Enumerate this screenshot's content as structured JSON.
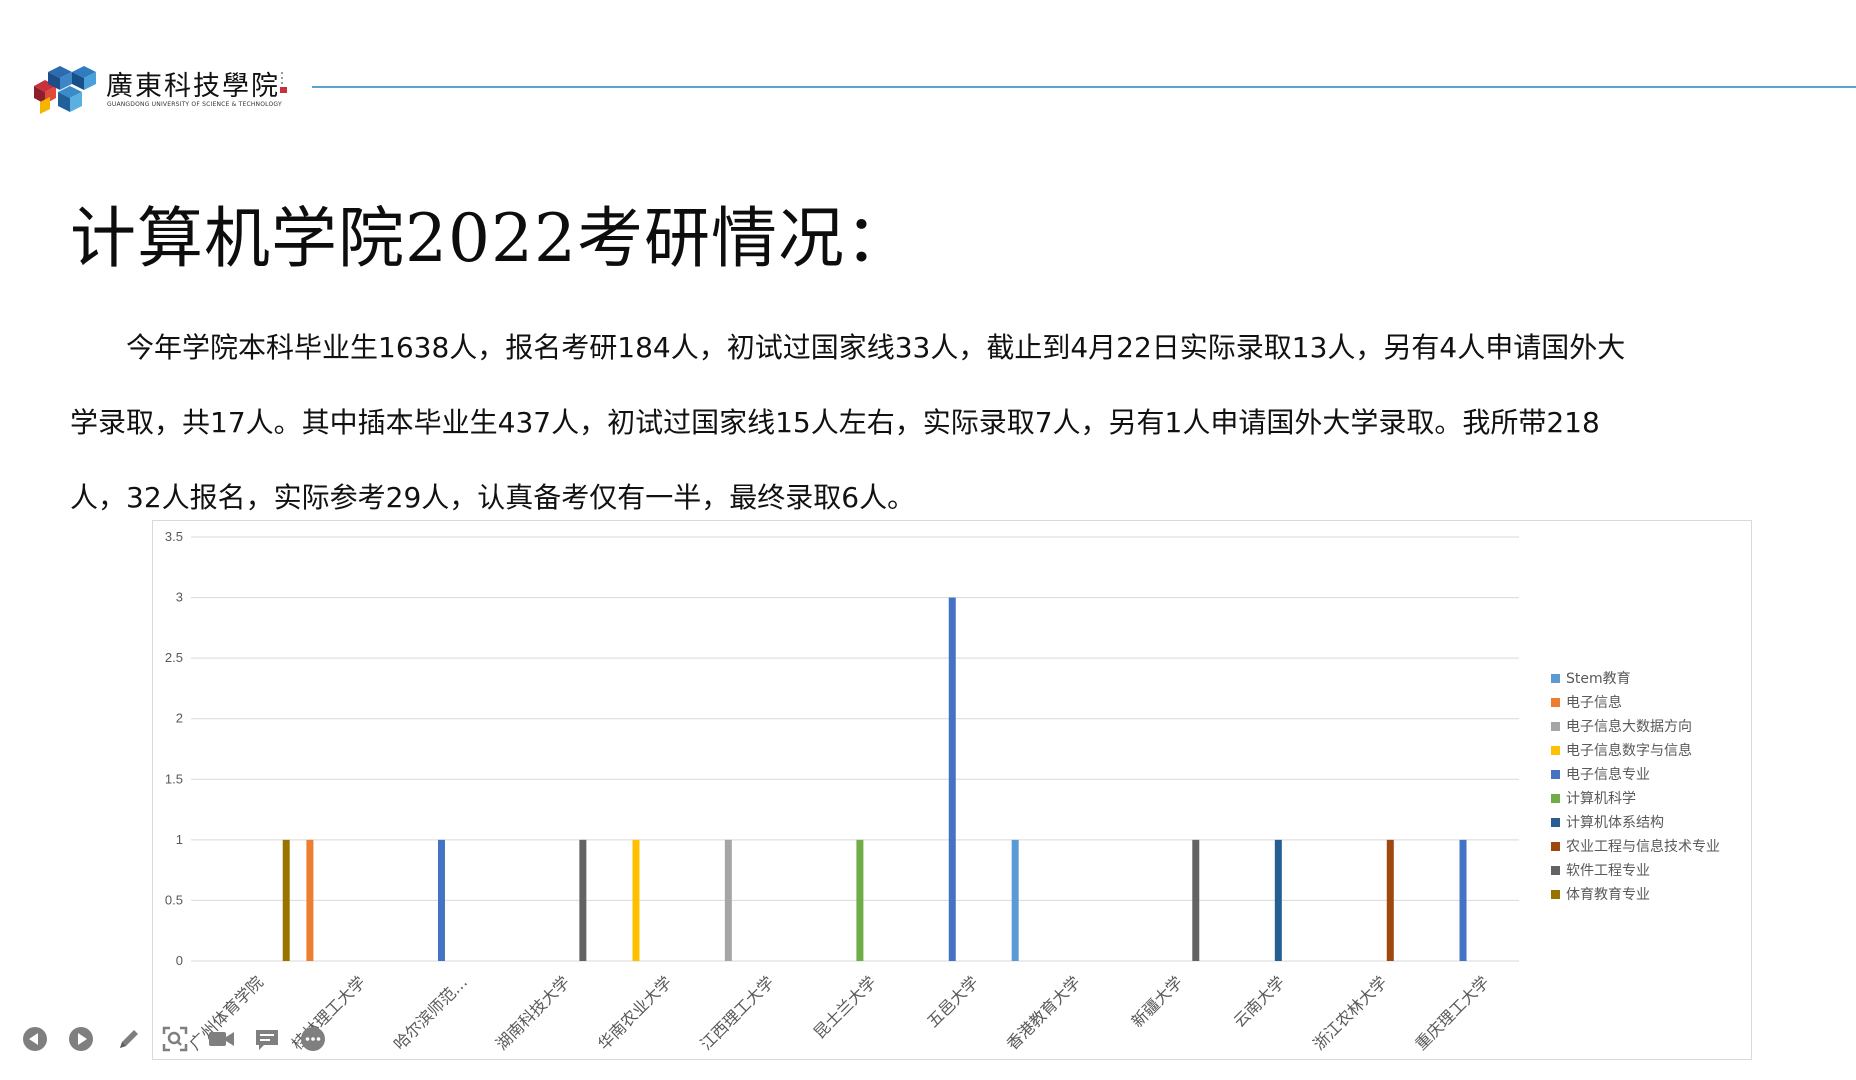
{
  "header": {
    "school_name": "廣東科技學院",
    "school_name_en": "GUANGDONG UNIVERSITY OF SCIENCE & TECHNOLOGY"
  },
  "slide": {
    "title": "计算机学院2022考研情况：",
    "paragraph_lines": [
      "　　今年学院本科毕业生1638人，报名考研184人，初试过国家线33人，截止到4月22日实际录取13人，另有4人申请国外大",
      "学录取，共17人。其中插本毕业生437人，初试过国家线15人左右，实际录取7人，另有1人申请国外大学录取。我所带218",
      "人，32人报名，实际参考29人，认真备考仅有一半，最终录取6人。"
    ]
  },
  "toolbar": {
    "icons": [
      "prev-icon",
      "next-icon",
      "pen-icon",
      "zoom-icon",
      "video-icon",
      "subtitle-icon",
      "more-icon"
    ]
  },
  "chart_data": {
    "type": "bar",
    "title": "",
    "xlabel": "",
    "ylabel": "",
    "ylim": [
      0,
      3.5
    ],
    "yticks": [
      "0",
      "0.5",
      "1",
      "1.5",
      "2",
      "2.5",
      "3",
      "3.5"
    ],
    "grid": true,
    "legend_position": "right",
    "categories": [
      "广州体育学院",
      "桂林理工大学",
      "哈尔滨师范…",
      "湖南科技大学",
      "华南农业大学",
      "江西理工大学",
      "昆士兰大学",
      "五邑大学",
      "香港教育大学",
      "新疆大学",
      "云南大学",
      "浙江农林大学",
      "重庆理工大学"
    ],
    "series": [
      {
        "name": "Stem教育",
        "color": "#5b9bd5",
        "values": [
          0,
          0,
          0,
          0,
          0,
          0,
          0,
          0,
          1,
          0,
          0,
          0,
          0
        ]
      },
      {
        "name": "电子信息",
        "color": "#ed7d31",
        "values": [
          0,
          1,
          0,
          0,
          0,
          0,
          0,
          0,
          0,
          0,
          0,
          0,
          0
        ]
      },
      {
        "name": "电子信息大数据方向",
        "color": "#a5a5a5",
        "values": [
          0,
          0,
          0,
          0,
          0,
          1,
          0,
          0,
          0,
          0,
          0,
          0,
          0
        ]
      },
      {
        "name": "电子信息数字与信息",
        "color": "#ffc000",
        "values": [
          0,
          0,
          0,
          0,
          1,
          0,
          0,
          0,
          0,
          0,
          0,
          0,
          0
        ]
      },
      {
        "name": "电子信息专业",
        "color": "#4472c4",
        "values": [
          0,
          0,
          1,
          0,
          0,
          0,
          0,
          3,
          0,
          0,
          0,
          0,
          1
        ]
      },
      {
        "name": "计算机科学",
        "color": "#70ad47",
        "values": [
          0,
          0,
          0,
          0,
          0,
          0,
          1,
          0,
          0,
          0,
          0,
          0,
          0
        ]
      },
      {
        "name": "计算机体系结构",
        "color": "#255e91",
        "values": [
          0,
          0,
          0,
          0,
          0,
          0,
          0,
          0,
          0,
          0,
          1,
          0,
          0
        ]
      },
      {
        "name": "农业工程与信息技术专业",
        "color": "#9e480e",
        "values": [
          0,
          0,
          0,
          0,
          0,
          0,
          0,
          0,
          0,
          0,
          0,
          1,
          0
        ]
      },
      {
        "name": "软件工程专业",
        "color": "#636363",
        "values": [
          0,
          0,
          0,
          1,
          0,
          0,
          0,
          0,
          0,
          1,
          0,
          0,
          0
        ]
      },
      {
        "name": "体育教育专业",
        "color": "#997300",
        "values": [
          1,
          0,
          0,
          0,
          0,
          0,
          0,
          0,
          0,
          0,
          0,
          0,
          0
        ]
      }
    ]
  }
}
